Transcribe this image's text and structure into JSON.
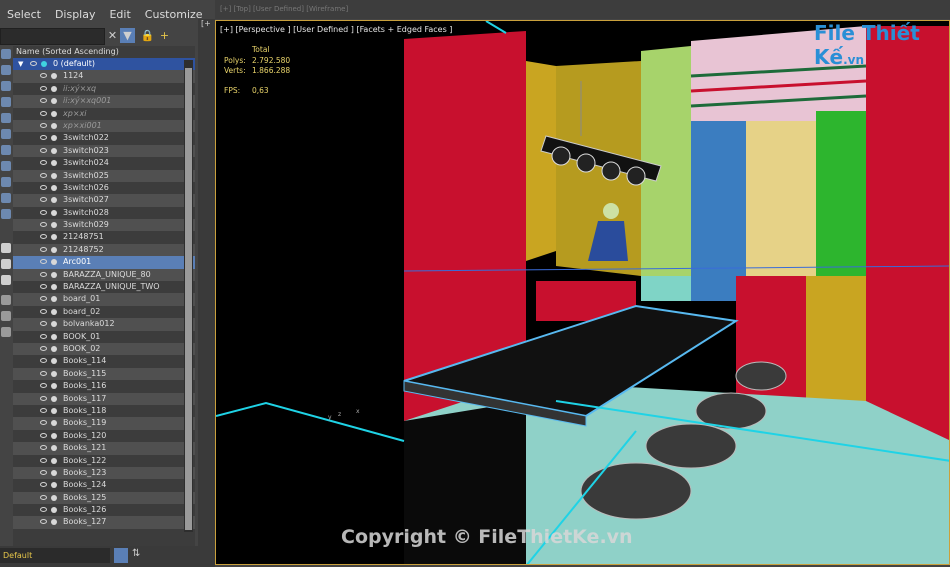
{
  "menu": [
    "Select",
    "Display",
    "Edit",
    "Customize"
  ],
  "scene": {
    "header": "Name (Sorted Ascending)",
    "rows": [
      {
        "name": "0 (default)",
        "kind": "root"
      },
      {
        "name": "1124",
        "kind": "layer"
      },
      {
        "name": "ii:xý×xq",
        "kind": "muted"
      },
      {
        "name": "ii:xý×xq001",
        "kind": "muted"
      },
      {
        "name": "xp×xi",
        "kind": "muted"
      },
      {
        "name": "xp×xi001",
        "kind": "muted"
      },
      {
        "name": "3switch022"
      },
      {
        "name": "3switch023"
      },
      {
        "name": "3switch024"
      },
      {
        "name": "3switch025"
      },
      {
        "name": "3switch026"
      },
      {
        "name": "3switch027"
      },
      {
        "name": "3switch028"
      },
      {
        "name": "3switch029"
      },
      {
        "name": "21248751"
      },
      {
        "name": "21248752"
      },
      {
        "name": "Arc001",
        "kind": "sel"
      },
      {
        "name": "BARAZZA_UNIQUE_80"
      },
      {
        "name": "BARAZZA_UNIQUE_TWO"
      },
      {
        "name": "board_01"
      },
      {
        "name": "board_02"
      },
      {
        "name": "bolvanka012"
      },
      {
        "name": "BOOK_01"
      },
      {
        "name": "BOOK_02"
      },
      {
        "name": "Books_114"
      },
      {
        "name": "Books_115"
      },
      {
        "name": "Books_116"
      },
      {
        "name": "Books_117"
      },
      {
        "name": "Books_118"
      },
      {
        "name": "Books_119"
      },
      {
        "name": "Books_120"
      },
      {
        "name": "Books_121"
      },
      {
        "name": "Books_122"
      },
      {
        "name": "Books_123"
      },
      {
        "name": "Books_124"
      },
      {
        "name": "Books_125"
      },
      {
        "name": "Books_126"
      },
      {
        "name": "Books_127"
      }
    ]
  },
  "status": {
    "layer": "Default"
  },
  "viewport": {
    "top_label": "[+] [Top] [User Defined] [Wireframe]",
    "label": "[+] [Perspective ] [User Defined ] [Facets + Edged Faces ]",
    "stats": {
      "header": "Total",
      "polys_label": "Polys:",
      "polys": "2.792.580",
      "verts_label": "Verts:",
      "verts": "1.866.288",
      "fps_label": "FPS:",
      "fps": "0,63"
    },
    "watermark": "Copyright © FileThietKe.vn",
    "logo": "File Thiết Kế",
    "logo_tld": ".vn"
  },
  "colors": {
    "accent": "#5a7fb6",
    "border": "#c9a03c"
  },
  "icons": [
    "close-icon",
    "filter-icon",
    "lock-icon",
    "add-layer-icon",
    "eye-icon",
    "layer-stack-icon"
  ]
}
